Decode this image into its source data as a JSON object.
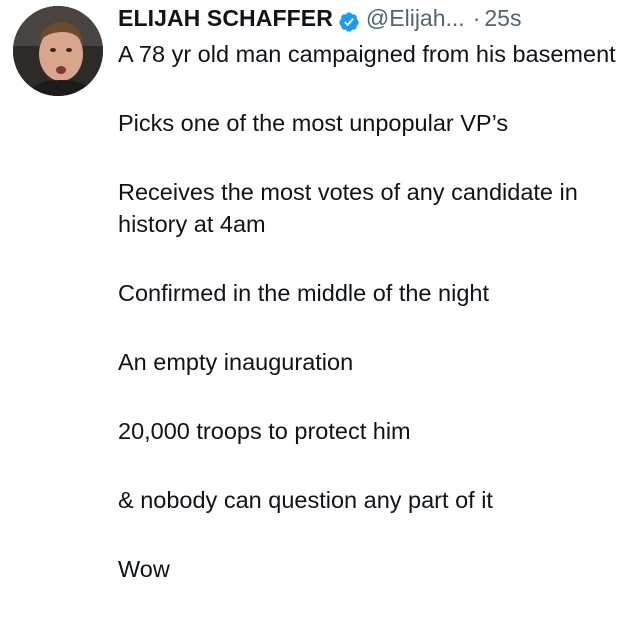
{
  "tweet": {
    "display_name": "ELIJAH SCHAFFER",
    "handle": "@Elijah...",
    "separator": "·",
    "time": "25s",
    "verified_icon": "verified-badge-icon",
    "accent_color": "#1d9bf0",
    "paragraphs": [
      "A 78 yr old man campaigned from his basement",
      "Picks one of the most unpopular VP’s",
      "Receives the most votes of any candidate in history at 4am",
      "Confirmed in the middle of the night",
      "An empty inauguration",
      "20,000 troops to protect him",
      "& nobody can question any part of it",
      "Wow"
    ]
  }
}
